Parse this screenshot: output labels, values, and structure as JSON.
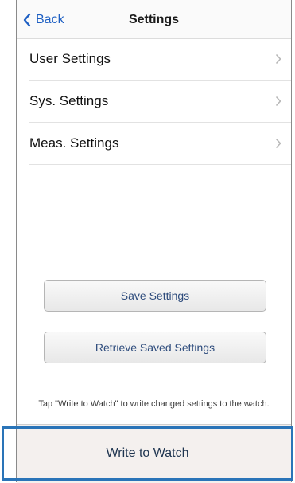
{
  "nav": {
    "back_label": "Back",
    "title": "Settings"
  },
  "menu": {
    "items": [
      {
        "label": "User Settings"
      },
      {
        "label": "Sys. Settings"
      },
      {
        "label": "Meas. Settings"
      }
    ]
  },
  "actions": {
    "save_label": "Save Settings",
    "retrieve_label": "Retrieve Saved Settings"
  },
  "hint": "Tap \"Write to Watch\" to write changed settings to the watch.",
  "write_button": {
    "label": "Write to Watch"
  },
  "colors": {
    "accent": "#1d5fc3",
    "highlight": "#2a74b8"
  },
  "icons": {
    "back": "chevron-left-icon",
    "row": "chevron-right-icon"
  }
}
